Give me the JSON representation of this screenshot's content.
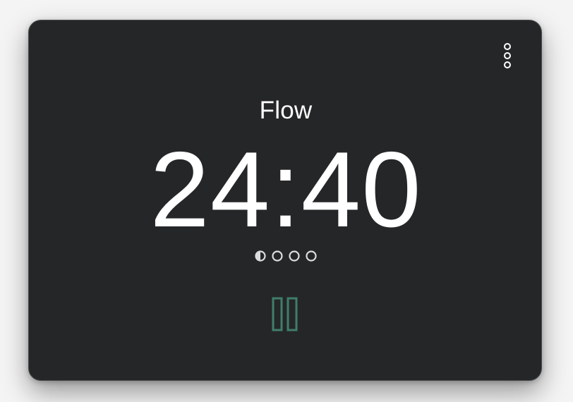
{
  "session": {
    "label": "Flow",
    "time_remaining": "24:40"
  },
  "progress": {
    "total_sessions": 4,
    "current_session_fill": 0.5,
    "completed_sessions": 0
  },
  "controls": {
    "menu_icon": "more-vertical-icon",
    "pause_icon": "pause-icon"
  },
  "colors": {
    "background": "#252628",
    "text": "#ffffff",
    "accent": "#3f7e6a",
    "indicator": "#dcdcdc"
  }
}
